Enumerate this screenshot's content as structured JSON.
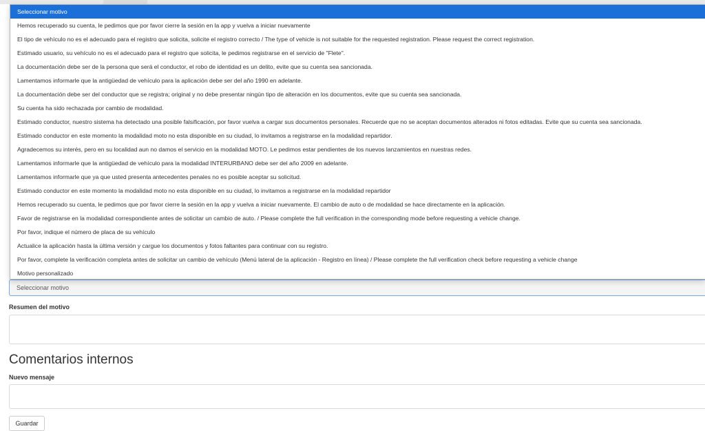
{
  "dropdown": {
    "options": [
      "Seleccionar motivo",
      "Hemos recuperado su cuenta, le pedimos que por favor cierre la sesión en la app y vuelva a iniciar nuevamente",
      "El tipo de vehículo no es el adecuado para el registro que solicita, solicite el registro correcto / The type of vehicle is not suitable for the requested registration. Please request the correct registration.",
      "Estimado usuario, su vehículo no es el adecuado para el registro que solicita, le pedimos registrarse en el servicio de \"Flete\".",
      "La documentación debe ser de la persona que será el conductor, el robo de identidad es un delito, evite que su cuenta sea sancionada.",
      "Lamentamos informarle que la antigüedad de vehículo para la aplicación debe ser del año 1990 en adelante.",
      "La documentación debe ser del conductor que se registra; original y no debe presentar ningún tipo de alteración en los documentos, evite que su cuenta sea sancionada.",
      "Su cuenta ha sido rechazada por cambio de modalidad.",
      "Estimado conductor, nuestro sistema ha detectado una posible falsificación, por favor vuelva a cargar sus documentos personales. Recuerde que no se aceptan documentos alterados ni fotos editadas. Evite que su cuenta sea sancionada.",
      "Estimado conductor en este momento la modalidad moto no esta disponible en su ciudad, lo invitamos a registrarse en la modalidad repartidor.",
      "Agradecemos su interés, pero en su localidad aun no damos el servicio en la modalidad MOTO. Le pedimos estar pendientes de los nuevos lanzamientos en nuestras redes.",
      "Lamentamos informarle que la antigüedad de vehículo para la modalidad INTERURBANO debe ser del año 2009 en adelante.",
      "Lamentamos informarle que ya que usted presenta antecedentes penales no es posible aceptar su solicitud.",
      "Estimado conductor en este momento la modalidad moto no esta disponible en su ciudad, lo invitamos a registrarse en la modalidad repartidor",
      "Hemos recuperado su cuenta, le pedimos que por favor cierre la sesión en la app y vuelva a iniciar nuevamente. El cambio de auto o de modalidad se hace directamente en la aplicación.",
      "Favor de registrarse en la modalidad correspondiente antes de solicitar un cambio de auto. / Please complete the full verification in the corresponding mode before requesting a vehicle change.",
      "Por favor, indique el número de placa de su vehículo",
      "Actualice la aplicación hasta la última versión y cargue los documentos y fotos faltantes para continuar con su registro.",
      "Por favor, complete la verificación completa antes de solicitar un cambio de vehículo (Menú lateral de la aplicación - Registro en línea) / Please complete the full verification check before requesting a vehicle change",
      "Motivo personalizado"
    ]
  },
  "form": {
    "select_value": "Seleccionar motivo",
    "summary_label": "Resumen del motivo",
    "comments_title": "Comentarios internos",
    "new_message_label": "Nuevo mensaje",
    "save_label": "Guardar"
  },
  "colors": {
    "selected_option": "#1b6fd9",
    "select_border": "#7aa7d9"
  }
}
